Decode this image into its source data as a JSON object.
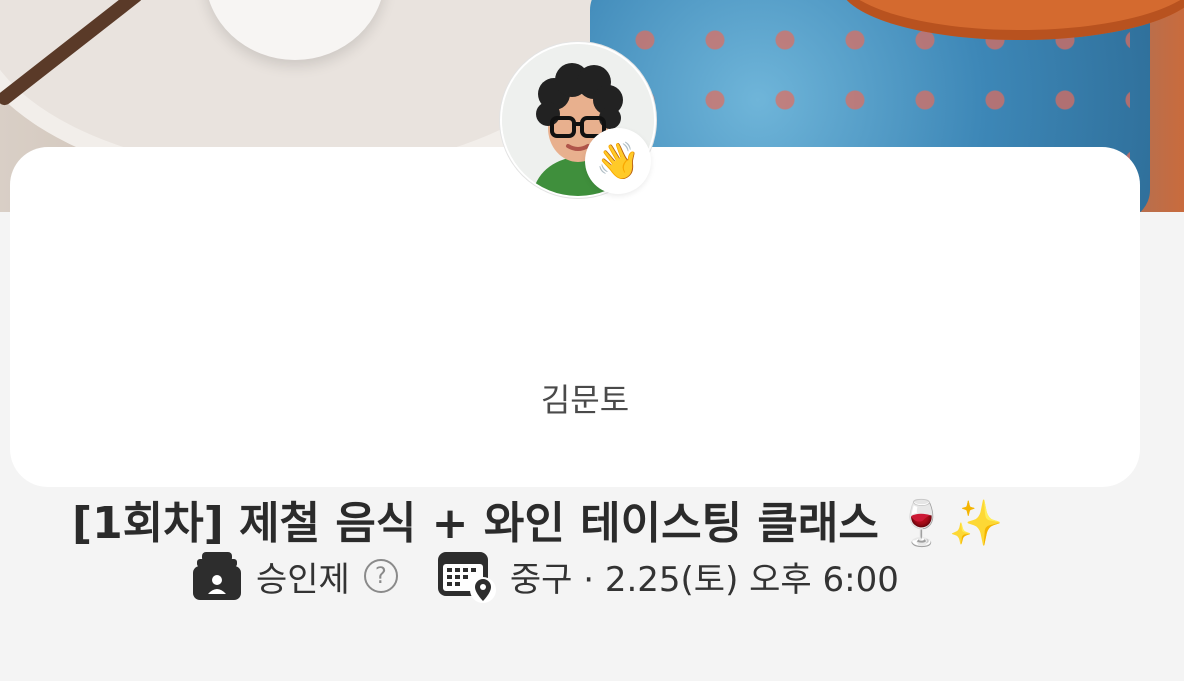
{
  "host": {
    "name": "김문토"
  },
  "event": {
    "title": "[1회차] 제철 음식 + 와인 테이스팅 클래스 🍷✨",
    "approval_label": "승인제",
    "help_glyph": "?",
    "schedule": "중구 · 2.25(토) 오후 6:00"
  },
  "icons": {
    "badge": "waving-hand",
    "approval": "approval-tray-icon",
    "calendar": "calendar-location-icon",
    "help": "help-icon"
  },
  "badge_emoji": "👋"
}
